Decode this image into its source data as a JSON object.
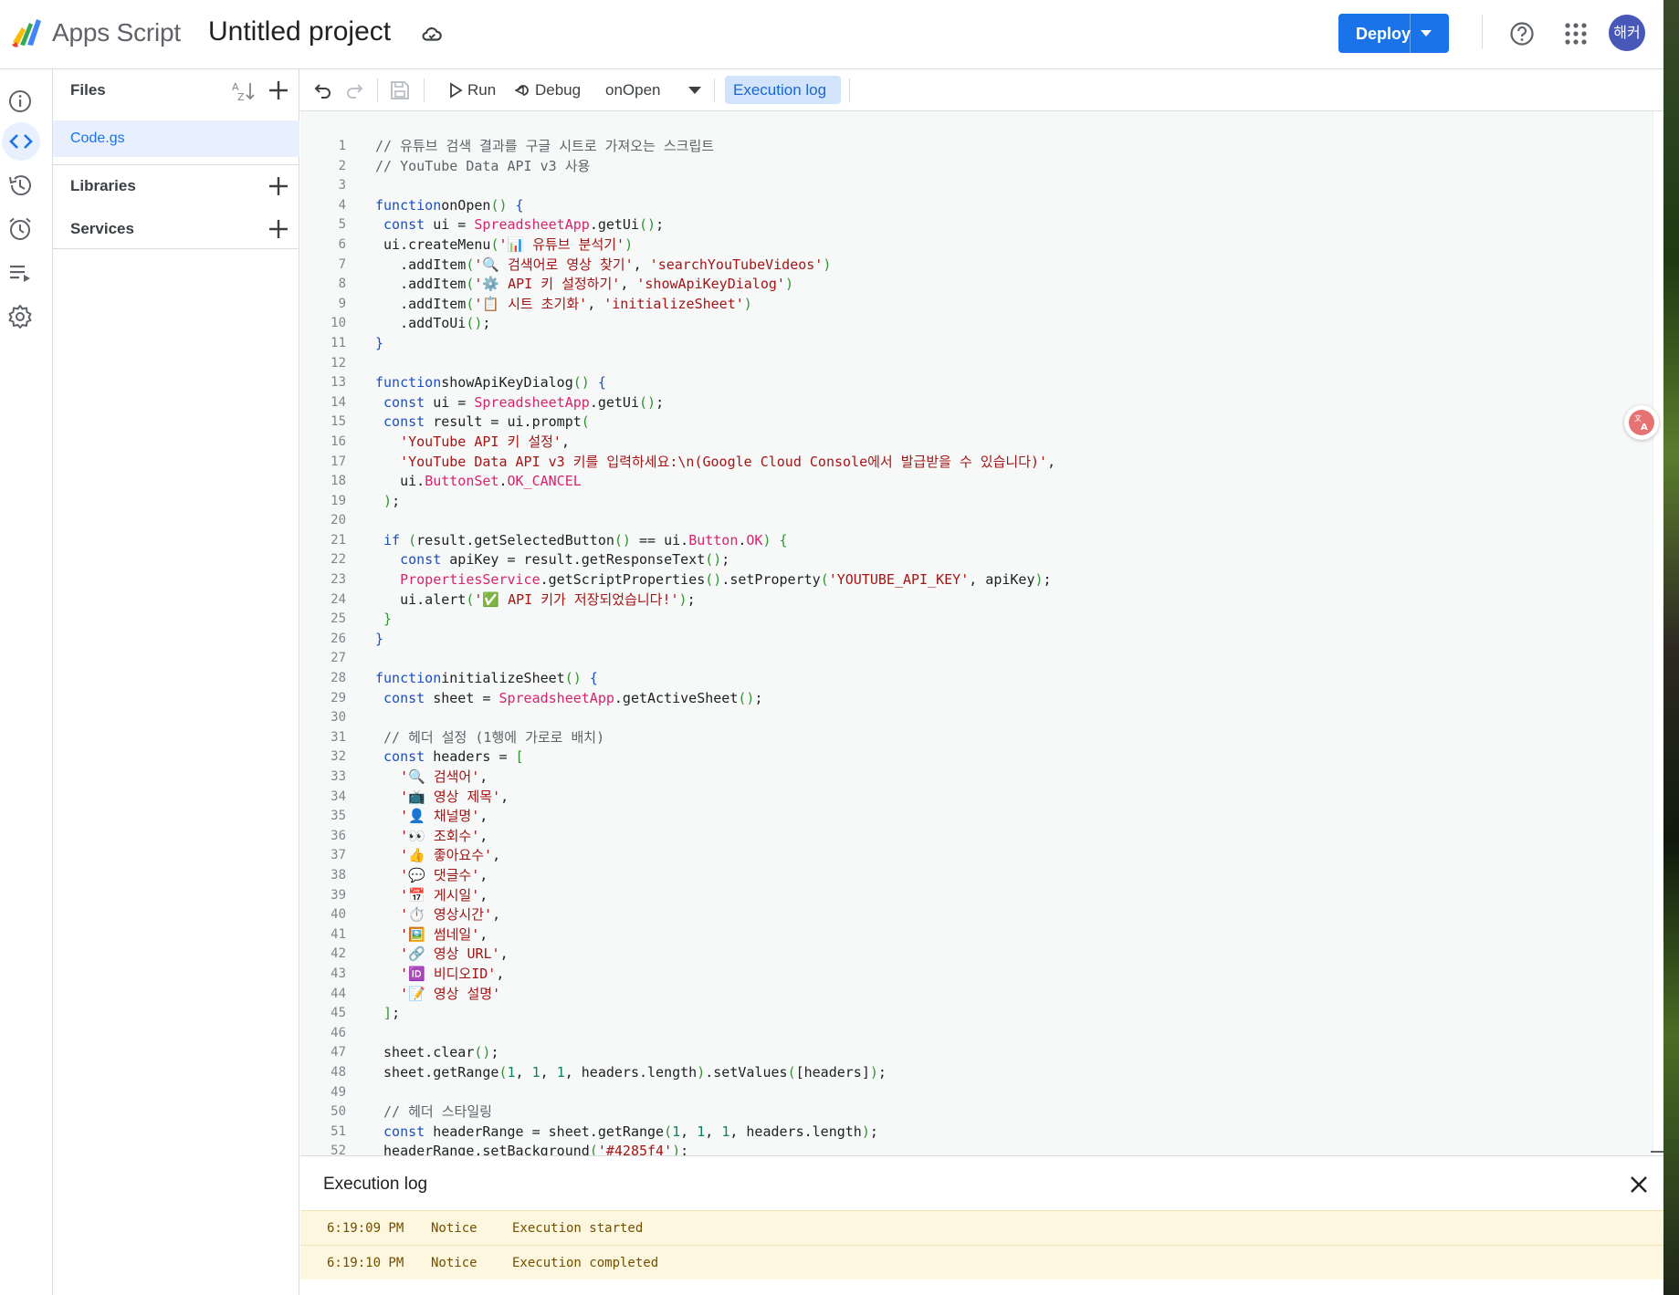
{
  "app": {
    "name": "Apps Script",
    "project_title": "Untitled project",
    "avatar_text": "해커",
    "colors": {
      "accent": "#1a73e8",
      "selected_bg": "#e8f0fe",
      "log_bg": "#fef7e0"
    }
  },
  "header": {
    "deploy_label": "Deploy",
    "icons": [
      "cloud-icon",
      "help-icon",
      "apps-grid-icon",
      "chevron-down-icon"
    ]
  },
  "rail": {
    "items": [
      "info-icon",
      "code-icon",
      "history-icon",
      "trigger-clock-icon",
      "executions-icon",
      "settings-icon"
    ]
  },
  "files_panel": {
    "files_label": "Files",
    "files": [
      {
        "name": "Code.gs",
        "selected": true
      }
    ],
    "libraries_label": "Libraries",
    "services_label": "Services"
  },
  "toolbar": {
    "run_label": "Run",
    "debug_label": "Debug",
    "function_selected": "onOpen",
    "execution_log_label": "Execution log"
  },
  "editor": {
    "line_numbers": [
      "1",
      "2",
      "3",
      "4",
      "5",
      "6",
      "7",
      "8",
      "9",
      "10",
      "11",
      "12",
      "13",
      "14",
      "15",
      "16",
      "17",
      "18",
      "19",
      "20",
      "21",
      "22",
      "23",
      "24",
      "25",
      "26",
      "27",
      "28",
      "29",
      "30",
      "31",
      "32",
      "33",
      "34",
      "35",
      "36",
      "37",
      "38",
      "39",
      "40",
      "41",
      "42",
      "43",
      "44",
      "45",
      "46",
      "47",
      "48",
      "49",
      "50",
      "51",
      "52"
    ],
    "lines": [
      [
        [
          "cm",
          "// 유튜브 검색 결과를 구글 시트로 가져오는 스크립트"
        ]
      ],
      [
        [
          "cm",
          "// YouTube Data API v3 사용"
        ]
      ],
      [],
      [
        [
          "kw",
          "function"
        ],
        [
          "",
          "onOpen"
        ],
        [
          "pn",
          "()"
        ],
        [
          "",
          " "
        ],
        [
          "kw",
          "{"
        ]
      ],
      [
        [
          "",
          " "
        ],
        [
          "kw",
          "const"
        ],
        [
          "",
          " ui = "
        ],
        [
          "cls",
          "SpreadsheetApp"
        ],
        [
          "",
          ".getUi"
        ],
        [
          "pn",
          "()"
        ],
        [
          "",
          ";"
        ]
      ],
      [
        [
          "",
          " ui.createMenu"
        ],
        [
          "pn",
          "("
        ],
        [
          "str",
          "'📊 유튜브 분석기'"
        ],
        [
          "pn",
          ")"
        ]
      ],
      [
        [
          "",
          "   .addItem"
        ],
        [
          "pn",
          "("
        ],
        [
          "str",
          "'🔍 검색어로 영상 찾기'"
        ],
        [
          "",
          ", "
        ],
        [
          "str",
          "'searchYouTubeVideos'"
        ],
        [
          "pn",
          ")"
        ]
      ],
      [
        [
          "",
          "   .addItem"
        ],
        [
          "pn",
          "("
        ],
        [
          "str",
          "'⚙️ API 키 설정하기'"
        ],
        [
          "",
          ", "
        ],
        [
          "str",
          "'showApiKeyDialog'"
        ],
        [
          "pn",
          ")"
        ]
      ],
      [
        [
          "",
          "   .addItem"
        ],
        [
          "pn",
          "("
        ],
        [
          "str",
          "'📋 시트 초기화'"
        ],
        [
          "",
          ", "
        ],
        [
          "str",
          "'initializeSheet'"
        ],
        [
          "pn",
          ")"
        ]
      ],
      [
        [
          "",
          "   .addToUi"
        ],
        [
          "pn",
          "()"
        ],
        [
          "",
          ";"
        ]
      ],
      [
        [
          "kw",
          "}"
        ]
      ],
      [],
      [
        [
          "kw",
          "function"
        ],
        [
          "",
          "showApiKeyDialog"
        ],
        [
          "pn",
          "()"
        ],
        [
          "",
          " "
        ],
        [
          "kw",
          "{"
        ]
      ],
      [
        [
          "",
          " "
        ],
        [
          "kw",
          "const"
        ],
        [
          "",
          " ui = "
        ],
        [
          "cls",
          "SpreadsheetApp"
        ],
        [
          "",
          ".getUi"
        ],
        [
          "pn",
          "()"
        ],
        [
          "",
          ";"
        ]
      ],
      [
        [
          "",
          " "
        ],
        [
          "kw",
          "const"
        ],
        [
          "",
          " result = ui.prompt"
        ],
        [
          "pn",
          "("
        ]
      ],
      [
        [
          "",
          "   "
        ],
        [
          "str",
          "'YouTube API 키 설정'"
        ],
        [
          "",
          ","
        ]
      ],
      [
        [
          "",
          "   "
        ],
        [
          "str",
          "'YouTube Data API v3 키를 입력하세요:\\n(Google Cloud Console에서 발급받을 수 있습니다)'"
        ],
        [
          "",
          ","
        ]
      ],
      [
        [
          "",
          "   ui."
        ],
        [
          "cls",
          "ButtonSet"
        ],
        [
          "",
          "."
        ],
        [
          "cls",
          "OK_CANCEL"
        ]
      ],
      [
        [
          "",
          " "
        ],
        [
          "pn",
          ")"
        ],
        [
          "",
          ";"
        ]
      ],
      [],
      [
        [
          "",
          " "
        ],
        [
          "kw",
          "if"
        ],
        [
          "",
          " "
        ],
        [
          "pn",
          "("
        ],
        [
          "",
          "result.getSelectedButton"
        ],
        [
          "pn",
          "()"
        ],
        [
          "",
          " == ui."
        ],
        [
          "cls",
          "Button"
        ],
        [
          "",
          "."
        ],
        [
          "cls",
          "OK"
        ],
        [
          "pn",
          ")"
        ],
        [
          "",
          " "
        ],
        [
          "pn",
          "{"
        ]
      ],
      [
        [
          "",
          "   "
        ],
        [
          "kw",
          "const"
        ],
        [
          "",
          " apiKey = result.getResponseText"
        ],
        [
          "pn",
          "()"
        ],
        [
          "",
          ";"
        ]
      ],
      [
        [
          "",
          "   "
        ],
        [
          "cls",
          "PropertiesService"
        ],
        [
          "",
          ".getScriptProperties"
        ],
        [
          "pn",
          "()"
        ],
        [
          "",
          ".setProperty"
        ],
        [
          "pn",
          "("
        ],
        [
          "str",
          "'YOUTUBE_API_KEY'"
        ],
        [
          "",
          ", apiKey"
        ],
        [
          "pn",
          ")"
        ],
        [
          "",
          ";"
        ]
      ],
      [
        [
          "",
          "   ui.alert"
        ],
        [
          "pn",
          "("
        ],
        [
          "str",
          "'✅ API 키가 저장되었습니다!'"
        ],
        [
          "pn",
          ")"
        ],
        [
          "",
          ";"
        ]
      ],
      [
        [
          "",
          " "
        ],
        [
          "pn",
          "}"
        ]
      ],
      [
        [
          "kw",
          "}"
        ]
      ],
      [],
      [
        [
          "kw",
          "function"
        ],
        [
          "",
          "initializeSheet"
        ],
        [
          "pn",
          "()"
        ],
        [
          "",
          " "
        ],
        [
          "kw",
          "{"
        ]
      ],
      [
        [
          "",
          " "
        ],
        [
          "kw",
          "const"
        ],
        [
          "",
          " sheet = "
        ],
        [
          "cls",
          "SpreadsheetApp"
        ],
        [
          "",
          ".getActiveSheet"
        ],
        [
          "pn",
          "()"
        ],
        [
          "",
          ";"
        ]
      ],
      [],
      [
        [
          "",
          " "
        ],
        [
          "cm",
          "// 헤더 설정 (1행에 가로로 배치)"
        ]
      ],
      [
        [
          "",
          " "
        ],
        [
          "kw",
          "const"
        ],
        [
          "",
          " headers = "
        ],
        [
          "pn",
          "["
        ]
      ],
      [
        [
          "",
          "   "
        ],
        [
          "str",
          "'🔍 검색어'"
        ],
        [
          "",
          ","
        ]
      ],
      [
        [
          "",
          "   "
        ],
        [
          "str",
          "'📺 영상 제목'"
        ],
        [
          "",
          ","
        ]
      ],
      [
        [
          "",
          "   "
        ],
        [
          "str",
          "'👤 채널명'"
        ],
        [
          "",
          ","
        ]
      ],
      [
        [
          "",
          "   "
        ],
        [
          "str",
          "'👀 조회수'"
        ],
        [
          "",
          ","
        ]
      ],
      [
        [
          "",
          "   "
        ],
        [
          "str",
          "'👍 좋아요수'"
        ],
        [
          "",
          ","
        ]
      ],
      [
        [
          "",
          "   "
        ],
        [
          "str",
          "'💬 댓글수'"
        ],
        [
          "",
          ","
        ]
      ],
      [
        [
          "",
          "   "
        ],
        [
          "str",
          "'📅 게시일'"
        ],
        [
          "",
          ","
        ]
      ],
      [
        [
          "",
          "   "
        ],
        [
          "str",
          "'⏱️ 영상시간'"
        ],
        [
          "",
          ","
        ]
      ],
      [
        [
          "",
          "   "
        ],
        [
          "str",
          "'🖼️ 썸네일'"
        ],
        [
          "",
          ","
        ]
      ],
      [
        [
          "",
          "   "
        ],
        [
          "str",
          "'🔗 영상 URL'"
        ],
        [
          "",
          ","
        ]
      ],
      [
        [
          "",
          "   "
        ],
        [
          "str",
          "'🆔 비디오ID'"
        ],
        [
          "",
          ","
        ]
      ],
      [
        [
          "",
          "   "
        ],
        [
          "str",
          "'📝 영상 설명'"
        ]
      ],
      [
        [
          "",
          " "
        ],
        [
          "pn",
          "]"
        ],
        [
          "",
          ";"
        ]
      ],
      [],
      [
        [
          "",
          " sheet.clear"
        ],
        [
          "pn",
          "()"
        ],
        [
          "",
          ";"
        ]
      ],
      [
        [
          "",
          " sheet.getRange"
        ],
        [
          "pn",
          "("
        ],
        [
          "num",
          "1"
        ],
        [
          "",
          ", "
        ],
        [
          "num",
          "1"
        ],
        [
          "",
          ", "
        ],
        [
          "num",
          "1"
        ],
        [
          "",
          ", headers.length"
        ],
        [
          "pn",
          ")"
        ],
        [
          "",
          ".setValues"
        ],
        [
          "pn",
          "("
        ],
        [
          "",
          "[headers]"
        ],
        [
          "pn",
          ")"
        ],
        [
          "",
          ";"
        ]
      ],
      [],
      [
        [
          "",
          " "
        ],
        [
          "cm",
          "// 헤더 스타일링"
        ]
      ],
      [
        [
          "",
          " "
        ],
        [
          "kw",
          "const"
        ],
        [
          "",
          " headerRange = sheet.getRange"
        ],
        [
          "pn",
          "("
        ],
        [
          "num",
          "1"
        ],
        [
          "",
          ", "
        ],
        [
          "num",
          "1"
        ],
        [
          "",
          ", "
        ],
        [
          "num",
          "1"
        ],
        [
          "",
          ", headers.length"
        ],
        [
          "pn",
          ")"
        ],
        [
          "",
          ";"
        ]
      ],
      [
        [
          "",
          " headerRange.setBackground"
        ],
        [
          "pn",
          "("
        ],
        [
          "str",
          "'#4285f4'"
        ],
        [
          "pn",
          ")"
        ],
        [
          "",
          ";"
        ]
      ]
    ]
  },
  "log": {
    "title": "Execution log",
    "entries": [
      {
        "time": "6:19:09 PM",
        "level": "Notice",
        "message": "Execution started"
      },
      {
        "time": "6:19:10 PM",
        "level": "Notice",
        "message": "Execution completed"
      }
    ]
  }
}
